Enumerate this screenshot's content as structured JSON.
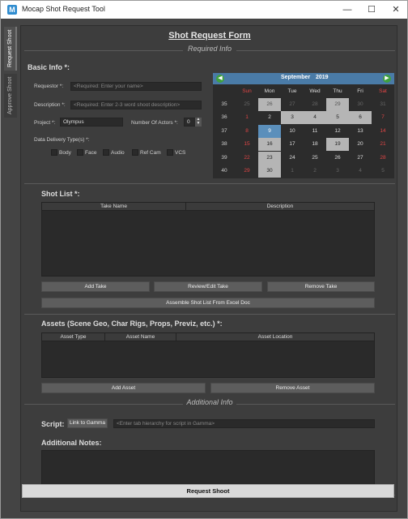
{
  "window": {
    "title": "Mocap Shot Request Tool",
    "icon": "M"
  },
  "side_tabs": [
    "Request Shoot",
    "Approve Shoot"
  ],
  "form": {
    "title": "Shot Request Form",
    "required_info": "Required Info",
    "additional_info": "Additional Info"
  },
  "basic_info": {
    "heading": "Basic Info *:",
    "requestor_label": "Requestor *:",
    "requestor_placeholder": "<Required:  Enter your name>",
    "description_label": "Description *:",
    "description_placeholder": "<Required:  Enter 2-3 word shoot description>",
    "project_label": "Project *:",
    "project_value": "Olympus",
    "actors_label": "Number Of Actors *:",
    "actors_value": "0",
    "delivery_label": "Data Delivery Type(s) *:",
    "delivery_types": [
      "Body",
      "Face",
      "Audio",
      "Ref Cam",
      "VCS"
    ]
  },
  "calendar": {
    "month": "September",
    "year": "2019",
    "day_headers": [
      "Sun",
      "Mon",
      "Tue",
      "Wed",
      "Thu",
      "Fri",
      "Sat"
    ],
    "weeks": [
      {
        "num": "35",
        "days": [
          "25",
          "26",
          "27",
          "28",
          "29",
          "30",
          "31"
        ]
      },
      {
        "num": "36",
        "days": [
          "1",
          "2",
          "3",
          "4",
          "5",
          "6",
          "7"
        ]
      },
      {
        "num": "37",
        "days": [
          "8",
          "9",
          "10",
          "11",
          "12",
          "13",
          "14"
        ]
      },
      {
        "num": "38",
        "days": [
          "15",
          "16",
          "17",
          "18",
          "19",
          "20",
          "21"
        ]
      },
      {
        "num": "39",
        "days": [
          "22",
          "23",
          "24",
          "25",
          "26",
          "27",
          "28"
        ]
      },
      {
        "num": "40",
        "days": [
          "29",
          "30",
          "1",
          "2",
          "3",
          "4",
          "5"
        ]
      }
    ],
    "selected_day": "9"
  },
  "shot_list": {
    "heading": "Shot List *:",
    "columns": [
      "Take Name",
      "Description"
    ],
    "buttons": [
      "Add Take",
      "Review/Edit Take",
      "Remove Take"
    ],
    "assemble_button": "Assemble Shot List From Excel Doc"
  },
  "assets": {
    "heading": "Assets (Scene Geo, Char Rigs, Props, Previz, etc.) *:",
    "columns": [
      "Asset Type",
      "Asset Name",
      "Asset Location"
    ],
    "buttons": [
      "Add Asset",
      "Remove Asset"
    ]
  },
  "additional": {
    "script_label": "Script:",
    "link_button": "Link to Gamma",
    "script_placeholder": "<Enter tab hierarchy for script in Gamma>",
    "notes_label": "Additional Notes:"
  },
  "submit_button": "Request Shoot"
}
